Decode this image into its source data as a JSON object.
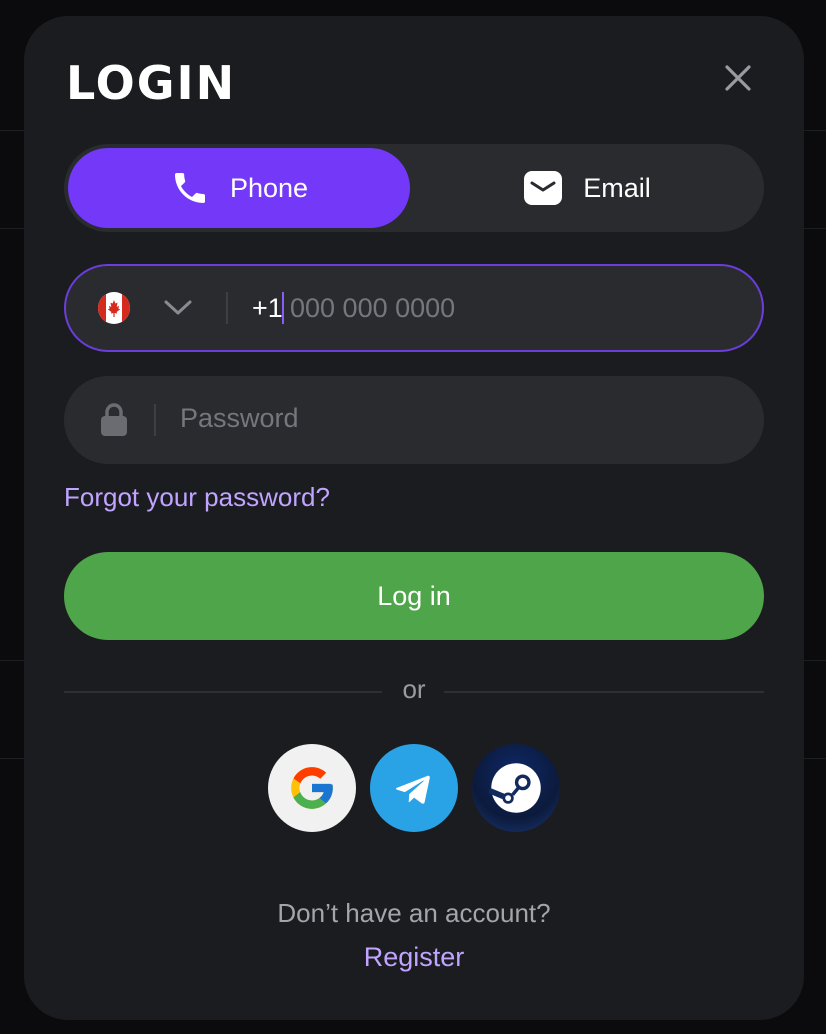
{
  "modal": {
    "title": "LOGIN"
  },
  "tabs": [
    {
      "label": "Phone",
      "icon": "phone-icon",
      "active": true
    },
    {
      "label": "Email",
      "icon": "envelope-icon",
      "active": false
    }
  ],
  "phone": {
    "country": "Canada",
    "flag_icon": "canada-flag-icon",
    "prefix": "+1",
    "placeholder": "000 000 0000",
    "value": ""
  },
  "password": {
    "placeholder": "Password",
    "value": ""
  },
  "links": {
    "forgot": "Forgot your password?",
    "register": "Register"
  },
  "buttons": {
    "login": "Log in"
  },
  "divider": {
    "text": "or"
  },
  "social": [
    {
      "name": "Google",
      "icon": "google-icon"
    },
    {
      "name": "Telegram",
      "icon": "telegram-icon"
    },
    {
      "name": "Steam",
      "icon": "steam-icon"
    }
  ],
  "footer": {
    "prompt": "Don’t have an account?"
  },
  "colors": {
    "accent": "#7338f8",
    "success": "#4fa64a",
    "link": "#c0a4ff",
    "surface": "#1b1c1f",
    "input": "#2a2b2f"
  }
}
